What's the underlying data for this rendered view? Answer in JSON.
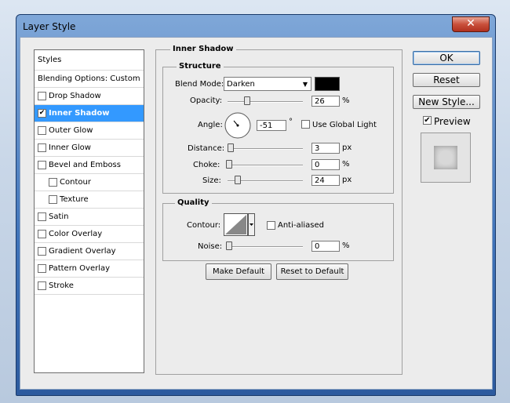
{
  "window": {
    "title": "Layer Style",
    "close_glyph": "✕"
  },
  "panel": {
    "header": "Styles",
    "blending": "Blending Options: Custom",
    "items": [
      {
        "label": "Drop Shadow",
        "checked": false
      },
      {
        "label": "Inner Shadow",
        "checked": true,
        "selected": true
      },
      {
        "label": "Outer Glow",
        "checked": false
      },
      {
        "label": "Inner Glow",
        "checked": false
      },
      {
        "label": "Bevel and Emboss",
        "checked": false
      },
      {
        "label": "Contour",
        "checked": false,
        "sub": true
      },
      {
        "label": "Texture",
        "checked": false,
        "sub": true
      },
      {
        "label": "Satin",
        "checked": false
      },
      {
        "label": "Color Overlay",
        "checked": false
      },
      {
        "label": "Gradient Overlay",
        "checked": false
      },
      {
        "label": "Pattern Overlay",
        "checked": false
      },
      {
        "label": "Stroke",
        "checked": false
      }
    ]
  },
  "section": {
    "title": "Inner Shadow",
    "structure": "Structure",
    "quality": "Quality"
  },
  "structure": {
    "blend_mode_label": "Blend Mode:",
    "blend_mode_value": "Darken",
    "blend_color": "#000000",
    "opacity_label": "Opacity:",
    "opacity_value": "26",
    "opacity_unit": "%",
    "angle_label": "Angle:",
    "angle_value": "-51",
    "angle_unit": "°",
    "global_light_label": "Use Global Light",
    "global_light_checked": false,
    "distance_label": "Distance:",
    "distance_value": "3",
    "distance_unit": "px",
    "choke_label": "Choke:",
    "choke_value": "0",
    "choke_unit": "%",
    "size_label": "Size:",
    "size_value": "24",
    "size_unit": "px"
  },
  "quality": {
    "contour_label": "Contour:",
    "anti_aliased_label": "Anti-aliased",
    "anti_aliased_checked": false,
    "noise_label": "Noise:",
    "noise_value": "0",
    "noise_unit": "%"
  },
  "buttons": {
    "make_default": "Make Default",
    "reset_default": "Reset to Default",
    "ok": "OK",
    "reset": "Reset",
    "new_style": "New Style...",
    "preview_label": "Preview",
    "preview_checked": true
  },
  "icons": {
    "dropdown": "chevron-down-icon",
    "close": "close-icon",
    "checkmark": "check-icon"
  }
}
